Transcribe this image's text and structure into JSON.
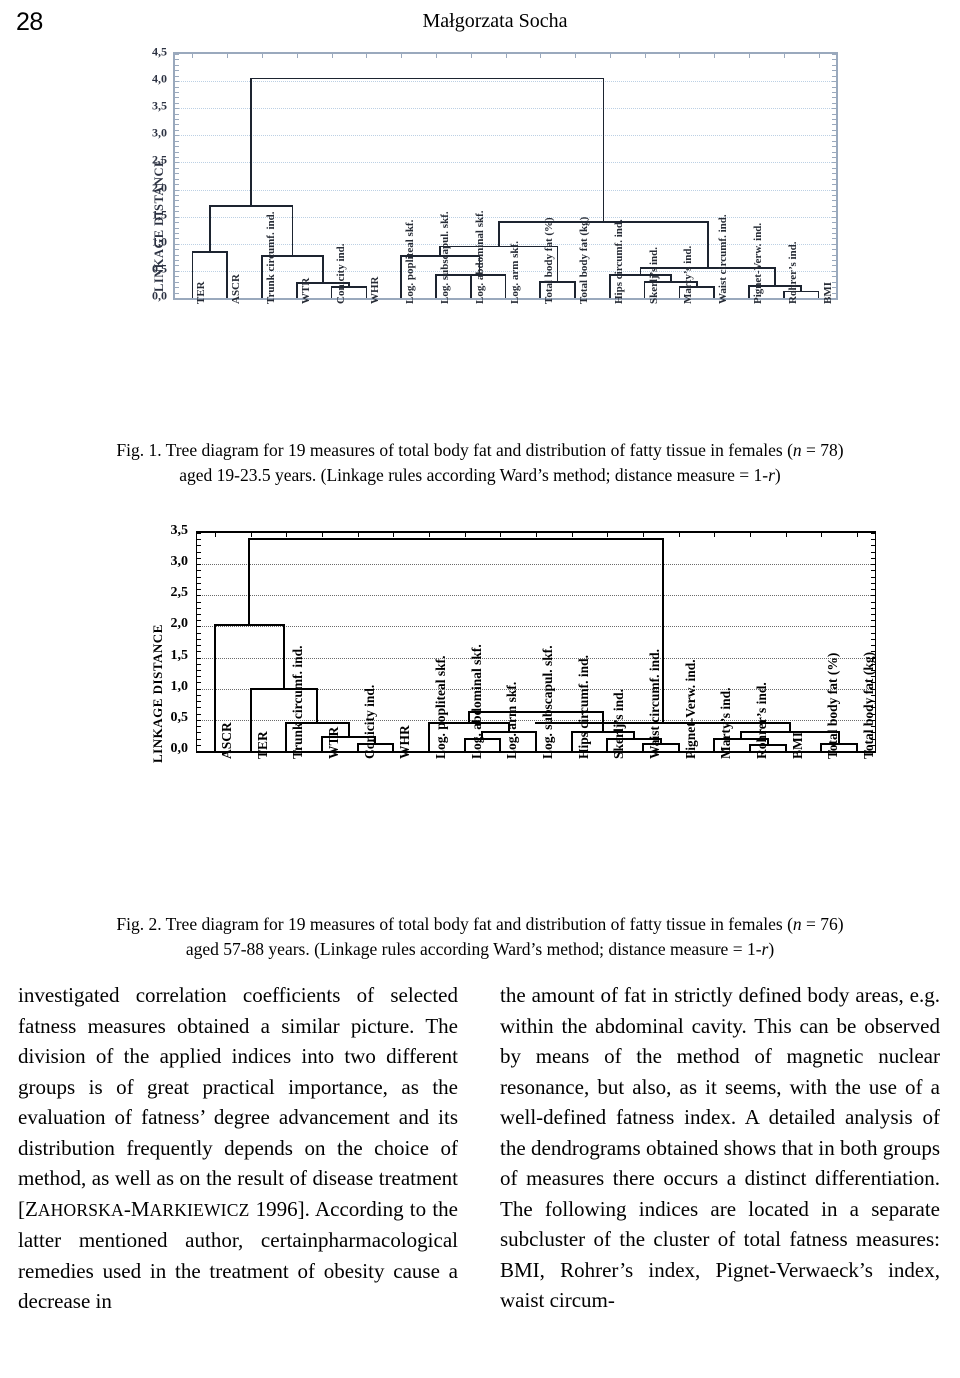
{
  "running_head": {
    "page_number": "28",
    "title": "Małgorzata Socha"
  },
  "figure1": {
    "caption_line1": "Fig. 1. Tree diagram for 19 measures of total body fat and distribution of fatty tissue in females (n = 78)",
    "caption_line2": "aged 19-23.5 years. (Linkage rules according Ward’s method; distance measure = 1-r)",
    "axis_label": "LINKAGE DISTANCE",
    "y_ticks": [
      "0,0",
      "0,5",
      "1,0",
      "1,5",
      "2,0",
      "2,5",
      "3,0",
      "3,5",
      "4,0",
      "4,5"
    ],
    "leaf_labels": [
      "TER",
      "ASCR",
      "Trunk circumf. ind.",
      "WTR",
      "Conicity ind.",
      "WHR",
      "Log. popliteal skf.",
      "Log. subscapul. skf.",
      "Log. abdominal skf.",
      "Log. arm skf.",
      "Total body fat (%)",
      "Total body fat (kg)",
      "Hips circumf. ind.",
      "Skerlj’s ind.",
      "Marty’s ind.",
      "Waist circumf. ind.",
      "Pignet-Verw. ind.",
      "Rohrer’s ind.",
      "BMI"
    ]
  },
  "figure2": {
    "caption_line1": "Fig. 2. Tree diagram for 19 measures of total body fat and distribution of fatty tissue in females (n = 76)",
    "caption_line2": "aged 57-88 years. (Linkage rules according Ward’s method; distance measure = 1-r)",
    "axis_label": "LINKAGE DISTANCE",
    "y_ticks": [
      "0,0",
      "0,5",
      "1,0",
      "1,5",
      "2,0",
      "2,5",
      "3,0",
      "3,5"
    ],
    "leaf_labels": [
      "ASCR",
      "TER",
      "Trunk circumf. ind.",
      "WTR",
      "Conicity ind.",
      "WHR",
      "Log. popliteal skf.",
      "Log. abdominal skf.",
      "Log. arm skf.",
      "Log. subscapul. skf.",
      "Hips circumf. ind.",
      "Skerlj’s ind.",
      "Waist circumf. ind.",
      "Pignet-Verw. ind.",
      "Marty’s ind.",
      "Rohrer’s ind.",
      "BMI",
      "Total body fat (%)",
      "Total body fat (kg)"
    ]
  },
  "chart_data": [
    {
      "type": "dendrogram",
      "title": "Fig. 1",
      "ylabel": "LINKAGE DISTANCE",
      "ylim": [
        0,
        4.5
      ],
      "ytick_step": 0.5,
      "grid": true,
      "leaves": [
        "TER",
        "ASCR",
        "Trunk circumf. ind.",
        "WTR",
        "Conicity ind.",
        "WHR",
        "Log. popliteal skf.",
        "Log. subscapul. skf.",
        "Log. abdominal skf.",
        "Log. arm skf.",
        "Total body fat (%)",
        "Total body fat (kg)",
        "Hips circumf. ind.",
        "Skerlj’s ind.",
        "Marty’s ind.",
        "Waist circumf. ind.",
        "Pignet-Verw. ind.",
        "Rohrer’s ind.",
        "BMI"
      ],
      "merges": [
        {
          "left": "TER",
          "right": "ASCR",
          "height": 0.85
        },
        {
          "left": "Conicity ind.",
          "right": "WHR",
          "height": 0.2
        },
        {
          "left": "WTR",
          "right": "n2",
          "height": 0.28
        },
        {
          "left": "Trunk circumf. ind.",
          "right": "n3",
          "height": 0.78
        },
        {
          "left": "n1",
          "right": "n4",
          "height": 1.7
        },
        {
          "left": "Log. subscapul. skf.",
          "right": "Log. abdominal skf.",
          "height": 0.42
        },
        {
          "left": "n6",
          "right": "Log. arm skf.",
          "height": 0.42
        },
        {
          "left": "Log. popliteal skf.",
          "right": "n7",
          "height": 0.78
        },
        {
          "left": "Total body fat (%)",
          "right": "Total body fat (kg)",
          "height": 0.3
        },
        {
          "left": "n8",
          "right": "n9",
          "height": 0.95
        },
        {
          "left": "Marty’s ind.",
          "right": "Waist circumf. ind.",
          "height": 0.2
        },
        {
          "left": "Skerlj’s ind.",
          "right": "n11",
          "height": 0.3
        },
        {
          "left": "Hips circumf. ind.",
          "right": "n12",
          "height": 0.42
        },
        {
          "left": "Rohrer’s ind.",
          "right": "BMI",
          "height": 0.12
        },
        {
          "left": "Pignet-Verw. ind.",
          "right": "n14",
          "height": 0.22
        },
        {
          "left": "n13",
          "right": "n15",
          "height": 0.55
        },
        {
          "left": "n10",
          "right": "n16",
          "height": 1.4
        },
        {
          "left": "n5",
          "right": "n17",
          "height": 4.05
        }
      ]
    },
    {
      "type": "dendrogram",
      "title": "Fig. 2",
      "ylabel": "LINKAGE DISTANCE",
      "ylim": [
        0,
        3.5
      ],
      "ytick_step": 0.5,
      "grid": true,
      "leaves": [
        "ASCR",
        "TER",
        "Trunk circumf. ind.",
        "WTR",
        "Conicity ind.",
        "WHR",
        "Log. popliteal skf.",
        "Log. abdominal skf.",
        "Log. arm skf.",
        "Log. subscapul. skf.",
        "Hips circumf. ind.",
        "Skerlj’s ind.",
        "Waist circumf. ind.",
        "Pignet-Verw. ind.",
        "Marty’s ind.",
        "Rohrer’s ind.",
        "BMI",
        "Total body fat (%)",
        "Total body fat (kg)"
      ],
      "merges": [
        {
          "left": "Conicity ind.",
          "right": "WHR",
          "height": 0.12
        },
        {
          "left": "WTR",
          "right": "n1",
          "height": 0.22
        },
        {
          "left": "Trunk circumf. ind.",
          "right": "n2",
          "height": 0.45
        },
        {
          "left": "TER",
          "right": "n3",
          "height": 1.0
        },
        {
          "left": "ASCR",
          "right": "n4",
          "height": 2.02
        },
        {
          "left": "Log. abdominal skf.",
          "right": "Log. arm skf.",
          "height": 0.2
        },
        {
          "left": "n6",
          "right": "Log. subscapul. skf.",
          "height": 0.3
        },
        {
          "left": "Log. popliteal skf.",
          "right": "n7",
          "height": 0.45
        },
        {
          "left": "Waist circumf. ind.",
          "right": "Pignet-Verw. ind.",
          "height": 0.12
        },
        {
          "left": "Skerlj’s ind.",
          "right": "n9",
          "height": 0.2
        },
        {
          "left": "Hips circumf. ind.",
          "right": "n10",
          "height": 0.3
        },
        {
          "left": "n8",
          "right": "n11",
          "height": 0.62
        },
        {
          "left": "Rohrer’s ind.",
          "right": "BMI",
          "height": 0.1
        },
        {
          "left": "Total body fat (%)",
          "right": "Total body fat (kg)",
          "height": 0.12
        },
        {
          "left": "Marty’s ind.",
          "right": "n13",
          "height": 0.2
        },
        {
          "left": "n15",
          "right": "n14",
          "height": 0.3
        },
        {
          "left": "n12",
          "right": "n16",
          "height": 0.45
        },
        {
          "left": "n5",
          "right": "n17",
          "height": 3.4
        }
      ]
    }
  ],
  "body": {
    "left_column": "investigated correlation coefficients of selected fatness measures obtained a similar picture. The division of the applied indices into two different groups is of great practical importance, as the evaluation of fatness’ degree advancement and its distribution frequently depends on the choice of method, as well as on the result of disease treatment [ZAHORSKA-MARKIEWICZ 1996]. According to the latter mentioned author, certainpharmacological remedies used in the treatment of obesity cause a decrease in",
    "right_column": "the amount of fat in strictly defined body areas, e.g. within the abdominal cavity. This can be observed by means of the method of magnetic nuclear resonance, but also, as it seems, with the use of a well-defined fatness index. A detailed analysis of the dendrograms obtained shows that in both groups of measures there occurs a distinct differentiation. The following indices are located in a separate subcluster of the cluster of total fatness measures: BMI, Rohrer’s index, Pignet-Verwaeck’s index, waist circum-"
  },
  "colors": {
    "fig1_frame": "#9aa9bd",
    "fig1_grid": "#bcd0e4",
    "fig1_ink": "#1d2430",
    "fig2_frame": "#000000",
    "fig2_grid": "#6b6b6b",
    "fig2_ink": "#000000"
  }
}
